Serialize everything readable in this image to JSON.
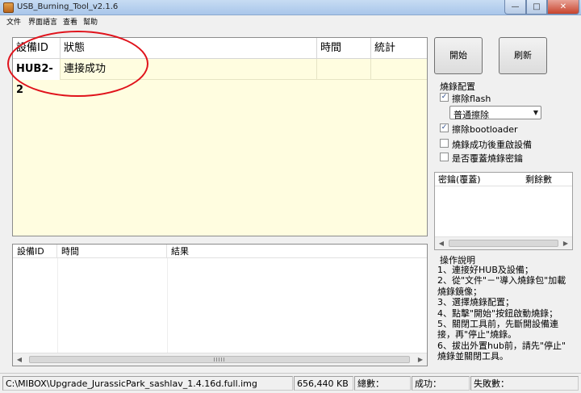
{
  "window": {
    "title": "USB_Burning_Tool_v2.1.6"
  },
  "menu": [
    "文件",
    "界面語言",
    "查看",
    "幫助"
  ],
  "main_grid": {
    "columns": [
      "設備ID",
      "狀態",
      "時間",
      "統計"
    ],
    "rows": [
      {
        "device_id": "HUB2-2",
        "status": "連接成功",
        "time": "",
        "stats": ""
      }
    ]
  },
  "log_grid": {
    "columns": [
      "設備ID",
      "時間",
      "結果"
    ]
  },
  "buttons": {
    "start": "開始",
    "refresh": "刷新"
  },
  "config": {
    "title": "燒錄配置",
    "erase_flash": {
      "label": "擦除flash",
      "checked": true
    },
    "erase_mode": "普通擦除",
    "erase_bootloader": {
      "label": "擦除bootloader",
      "checked": true
    },
    "reboot_after": {
      "label": "燒錄成功後重啟設備",
      "checked": false
    },
    "overwrite_key": {
      "label": "是否覆蓋燒錄密鑰",
      "checked": false
    }
  },
  "key_list": {
    "columns": [
      "密鑰(覆蓋)",
      "剩餘數"
    ]
  },
  "help": {
    "title": "操作說明",
    "lines": [
      "1、連接好HUB及設備；",
      "2、從\"文件\"－\"導入燒錄包\"加載",
      "燒錄鏡像；",
      "3、選擇燒錄配置；",
      "4、點擊\"開始\"按鈕啟動燒錄；",
      "5、關閉工具前，先斷開設備連",
      "接，再\"停止\"燒錄。",
      "6、拔出外置hub前，請先\"停止\"",
      "燒錄並關閉工具。"
    ]
  },
  "status_bar": {
    "path": "C:\\MIBOX\\Upgrade_JurassicPark_sashlav_1.4.16d.full.img",
    "size": "656,440 KB",
    "total_label": "總數：",
    "success_label": "成功：",
    "fail_label": "失敗數："
  },
  "colors": {
    "annotation": "#e0121b",
    "grid_bg": "#fffde0"
  },
  "icons": {
    "check": "check-icon",
    "dropdown": "chevron-down-icon"
  }
}
